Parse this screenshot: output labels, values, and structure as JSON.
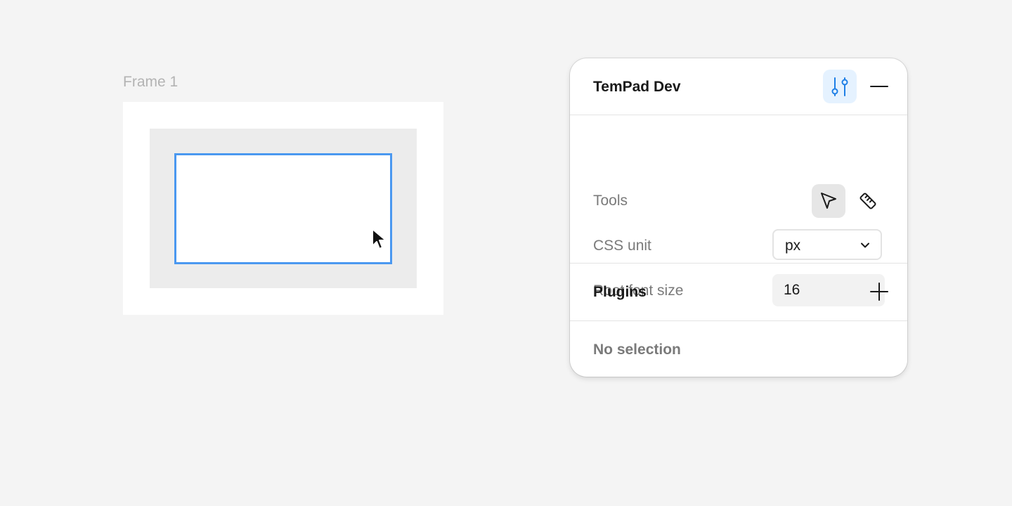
{
  "canvas": {
    "frame_label": "Frame 1"
  },
  "panel": {
    "title": "TemPad Dev",
    "header_icons": [
      "preferences-sliders-icon",
      "minimize-icon"
    ],
    "tools": {
      "label": "Tools",
      "items": [
        {
          "icon": "select-cursor-icon",
          "active": true
        },
        {
          "icon": "measure-ruler-icon",
          "active": false
        }
      ]
    },
    "css_unit": {
      "label": "CSS unit",
      "value": "px"
    },
    "root_font_size": {
      "label": "Root font size",
      "value": "16"
    },
    "plugins": {
      "title": "Plugins",
      "add_icon": "plus-icon"
    },
    "selection": {
      "empty_text": "No selection"
    }
  },
  "colors": {
    "background": "#f4f4f4",
    "selection_outline": "#4a98f0",
    "accent_bg": "#e5f2ff",
    "accent_icon": "#1e7fe6"
  }
}
